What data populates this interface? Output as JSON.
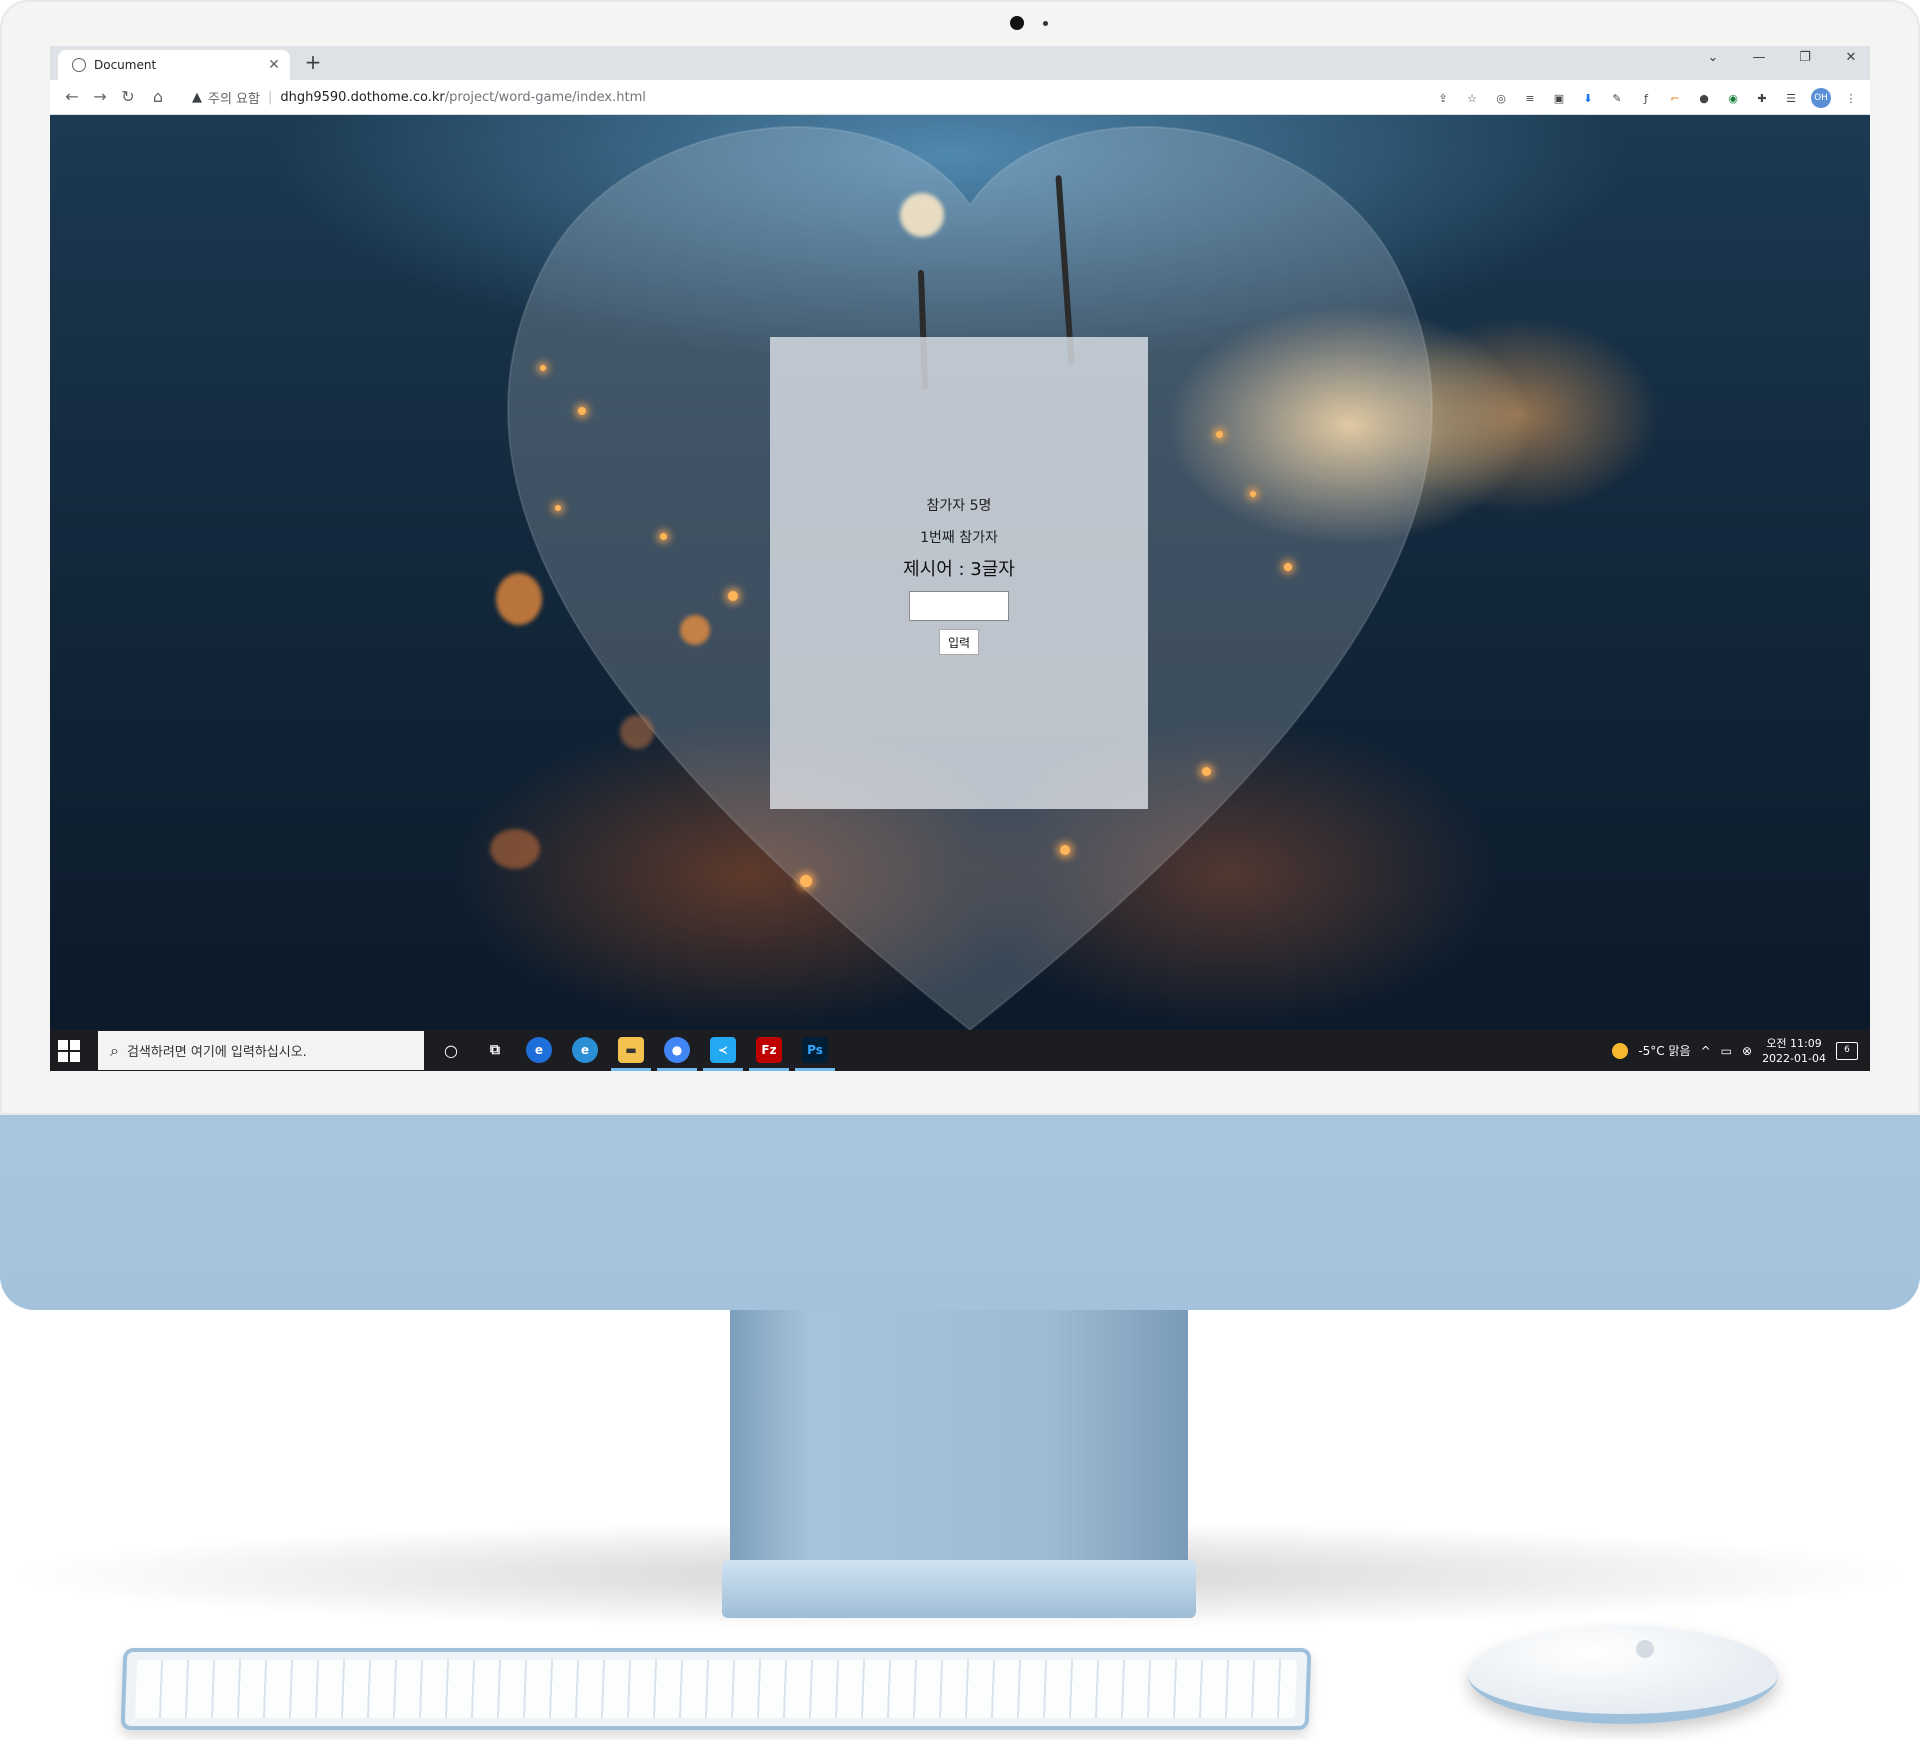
{
  "browser": {
    "tab_title": "Document",
    "tab_close": "✕",
    "new_tab": "+",
    "security_warning": "주의 요함",
    "url_host": "dhgh9590.dothome.co.kr",
    "url_path": "/project/word-game/index.html",
    "profile_initials": "OH",
    "window_controls": [
      "⌄",
      "—",
      "❐",
      "✕"
    ]
  },
  "game": {
    "players_text": "참가자 5명",
    "turn_text": "1번째 참가자",
    "hint_text": "제시어 : 3글자",
    "input_value": "",
    "submit_label": "입력"
  },
  "taskbar": {
    "search_placeholder": "검색하려면 여기에 입력하십시오.",
    "weather": "-5°C 맑음",
    "time_period": "오전 11:09",
    "date": "2022-01-04",
    "notification_count": "6",
    "apps": [
      "ie",
      "edge",
      "file-explorer",
      "chrome",
      "vscode",
      "filezilla",
      "photoshop"
    ]
  },
  "colors": {
    "imac_chin": "#a9c6e0",
    "taskbar": "#1c1d21",
    "card": "#e2e6ec"
  }
}
